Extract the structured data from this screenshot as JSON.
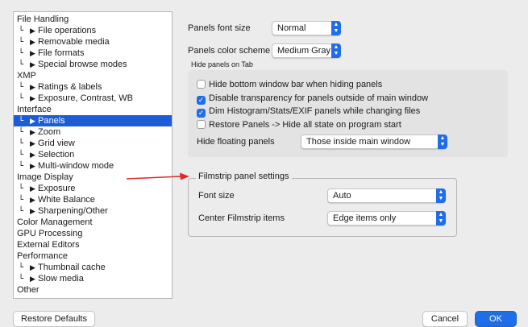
{
  "sidebar": {
    "items": [
      {
        "label": "File Handling",
        "child": false,
        "selected": false
      },
      {
        "label": "File operations",
        "child": true,
        "selected": false
      },
      {
        "label": "Removable media",
        "child": true,
        "selected": false
      },
      {
        "label": "File formats",
        "child": true,
        "selected": false
      },
      {
        "label": "Special browse modes",
        "child": true,
        "selected": false
      },
      {
        "label": "XMP",
        "child": false,
        "selected": false
      },
      {
        "label": "Ratings & labels",
        "child": true,
        "selected": false
      },
      {
        "label": "Exposure, Contrast, WB",
        "child": true,
        "selected": false
      },
      {
        "label": "Interface",
        "child": false,
        "selected": false
      },
      {
        "label": "Panels",
        "child": true,
        "selected": true
      },
      {
        "label": "Zoom",
        "child": true,
        "selected": false
      },
      {
        "label": "Grid view",
        "child": true,
        "selected": false
      },
      {
        "label": "Selection",
        "child": true,
        "selected": false
      },
      {
        "label": "Multi-window mode",
        "child": true,
        "selected": false
      },
      {
        "label": "Image Display",
        "child": false,
        "selected": false
      },
      {
        "label": "Exposure",
        "child": true,
        "selected": false
      },
      {
        "label": "White Balance",
        "child": true,
        "selected": false
      },
      {
        "label": "Sharpening/Other",
        "child": true,
        "selected": false
      },
      {
        "label": "Color Management",
        "child": false,
        "selected": false
      },
      {
        "label": "GPU Processing",
        "child": false,
        "selected": false
      },
      {
        "label": "External Editors",
        "child": false,
        "selected": false
      },
      {
        "label": "Performance",
        "child": false,
        "selected": false
      },
      {
        "label": "Thumbnail cache",
        "child": true,
        "selected": false
      },
      {
        "label": "Slow media",
        "child": true,
        "selected": false
      },
      {
        "label": "Other",
        "child": false,
        "selected": false
      }
    ]
  },
  "panels": {
    "font_size_label": "Panels font size",
    "font_size_value": "Normal",
    "color_scheme_label": "Panels color scheme",
    "color_scheme_value": "Medium Gray",
    "hide_group_title": "Hide panels on Tab",
    "checkboxes": [
      {
        "label": "Hide bottom window bar when hiding panels",
        "checked": false
      },
      {
        "label": "Disable transparency for panels outside of main window",
        "checked": true
      },
      {
        "label": "Dim Histogram/Stats/EXIF panels while changing files",
        "checked": true
      },
      {
        "label": "Restore Panels -> Hide all state on program start",
        "checked": false
      }
    ],
    "hide_floating_label": "Hide floating panels",
    "hide_floating_value": "Those inside main window"
  },
  "filmstrip": {
    "title": "Filmstrip panel settings",
    "font_size_label": "Font size",
    "font_size_value": "Auto",
    "center_label": "Center Filmstrip items",
    "center_value": "Edge items only"
  },
  "buttons": {
    "restore": "Restore Defaults",
    "cancel": "Cancel",
    "ok": "OK"
  },
  "colors": {
    "accent": "#1f6ee8",
    "selection": "#1c5cd6",
    "annotation_arrow": "#e02a2a"
  },
  "icons": {
    "tree_branch": "tree-branch-icon",
    "disclosure": "triangle-right-icon",
    "popup_stepper": "chevron-updown-icon",
    "check": "checkmark-icon"
  }
}
